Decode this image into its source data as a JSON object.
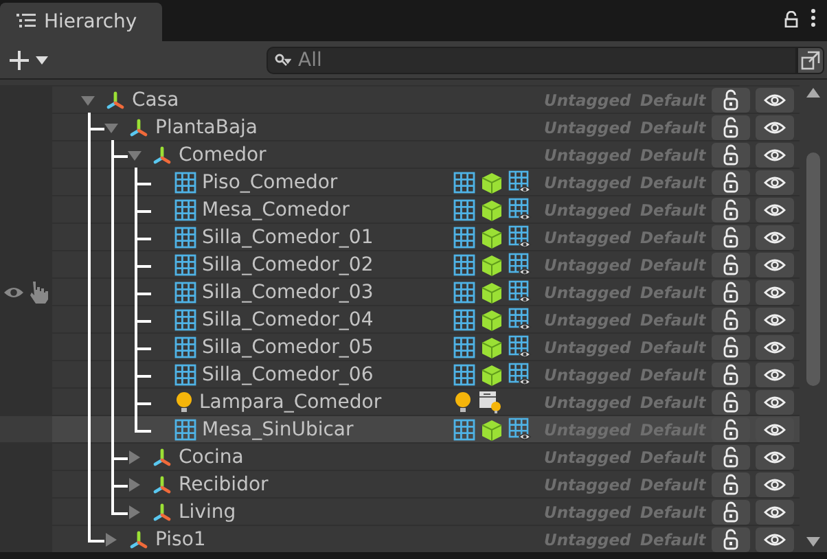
{
  "tab": {
    "title": "Hierarchy",
    "selected": true
  },
  "search": {
    "placeholder": "All"
  },
  "tree": [
    {
      "name": "Casa",
      "kind": "group",
      "expanded": true,
      "tag": "Untagged",
      "layer": "Default",
      "children": [
        {
          "name": "PlantaBaja",
          "kind": "group",
          "expanded": true,
          "tag": "Untagged",
          "layer": "Default",
          "children": [
            {
              "name": "Comedor",
              "kind": "group",
              "expanded": true,
              "tag": "Untagged",
              "layer": "Default",
              "children": [
                {
                  "name": "Piso_Comedor",
                  "kind": "mesh",
                  "tag": "Untagged",
                  "layer": "Default"
                },
                {
                  "name": "Mesa_Comedor",
                  "kind": "mesh",
                  "tag": "Untagged",
                  "layer": "Default"
                },
                {
                  "name": "Silla_Comedor_01",
                  "kind": "mesh",
                  "tag": "Untagged",
                  "layer": "Default"
                },
                {
                  "name": "Silla_Comedor_02",
                  "kind": "mesh",
                  "tag": "Untagged",
                  "layer": "Default"
                },
                {
                  "name": "Silla_Comedor_03",
                  "kind": "mesh",
                  "tag": "Untagged",
                  "layer": "Default",
                  "hovered": true
                },
                {
                  "name": "Silla_Comedor_04",
                  "kind": "mesh",
                  "tag": "Untagged",
                  "layer": "Default"
                },
                {
                  "name": "Silla_Comedor_05",
                  "kind": "mesh",
                  "tag": "Untagged",
                  "layer": "Default"
                },
                {
                  "name": "Silla_Comedor_06",
                  "kind": "mesh",
                  "tag": "Untagged",
                  "layer": "Default"
                },
                {
                  "name": "Lampara_Comedor",
                  "kind": "light",
                  "tag": "Untagged",
                  "layer": "Default"
                },
                {
                  "name": "Mesa_SinUbicar",
                  "kind": "mesh",
                  "tag": "Untagged",
                  "layer": "Default",
                  "selected": true
                }
              ]
            },
            {
              "name": "Cocina",
              "kind": "group",
              "expanded": false,
              "tag": "Untagged",
              "layer": "Default"
            },
            {
              "name": "Recibidor",
              "kind": "group",
              "expanded": false,
              "tag": "Untagged",
              "layer": "Default"
            },
            {
              "name": "Living",
              "kind": "group",
              "expanded": false,
              "tag": "Untagged",
              "layer": "Default"
            }
          ]
        },
        {
          "name": "Piso1",
          "kind": "group",
          "expanded": false,
          "tag": "Untagged",
          "layer": "Default"
        }
      ]
    }
  ]
}
